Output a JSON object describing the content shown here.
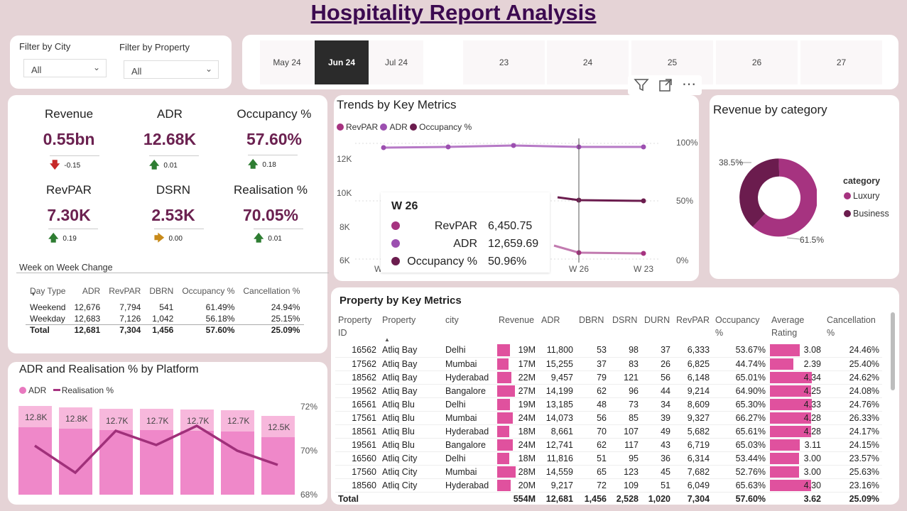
{
  "title": "Hospitality Report Analysis",
  "filters": {
    "city_label": "Filter by City",
    "city_value": "All",
    "property_label": "Filter by Property",
    "property_value": "All"
  },
  "slicer": {
    "items": [
      "May 24",
      "Jun 24",
      "Jul 24",
      "23",
      "24",
      "25",
      "26",
      "27"
    ],
    "selected": "Jun 24"
  },
  "kpis": [
    {
      "title": "Revenue",
      "value": "0.55bn",
      "delta": "-0.15",
      "trend": "down"
    },
    {
      "title": "ADR",
      "value": "12.68K",
      "delta": "0.01",
      "trend": "up"
    },
    {
      "title": "Occupancy %",
      "value": "57.60%",
      "delta": "0.18",
      "trend": "up"
    },
    {
      "title": "RevPAR",
      "value": "7.30K",
      "delta": "0.19",
      "trend": "up"
    },
    {
      "title": "DSRN",
      "value": "2.53K",
      "delta": "0.00",
      "trend": "flat"
    },
    {
      "title": "Realisation %",
      "value": "70.05%",
      "delta": "0.01",
      "trend": "up"
    }
  ],
  "week_table": {
    "title": "Week on Week Change",
    "headers": [
      "Day Type",
      "ADR",
      "RevPAR",
      "DBRN",
      "Occupancy %",
      "Cancellation %"
    ],
    "rows": [
      [
        "Weekend",
        "12,676",
        "7,794",
        "541",
        "61.49%",
        "24.94%"
      ],
      [
        "Weekday",
        "12,683",
        "7,126",
        "1,042",
        "56.18%",
        "25.15%"
      ]
    ],
    "total": [
      "Total",
      "12,681",
      "7,304",
      "1,456",
      "57.60%",
      "25.09%"
    ]
  },
  "trends": {
    "title": "Trends by Key Metrics",
    "legend": [
      "RevPAR",
      "ADR",
      "Occupancy %"
    ],
    "y_ticks": [
      "12K",
      "10K",
      "8K",
      "6K"
    ],
    "y2_ticks": [
      "100%",
      "50%",
      "0%"
    ],
    "x_ticks": [
      "W 26",
      "W 23"
    ],
    "x_partial": "W",
    "tooltip": {
      "title": "W 26",
      "rows": [
        {
          "label": "RevPAR",
          "value": "6,450.75"
        },
        {
          "label": "ADR",
          "value": "12,659.69"
        },
        {
          "label": "Occupancy %",
          "value": "50.96%"
        }
      ]
    }
  },
  "category": {
    "title": "Revenue by category",
    "legend_title": "category",
    "items": [
      "Luxury",
      "Business"
    ],
    "labels": [
      "38.5%",
      "61.5%"
    ]
  },
  "platform": {
    "title": "ADR and Realisation % by Platform",
    "legend": [
      "ADR",
      "Realisation %"
    ],
    "bar_labels": [
      "12.8K",
      "12.8K",
      "12.7K",
      "12.7K",
      "12.7K",
      "12.7K",
      "12.5K"
    ],
    "y2_ticks": [
      "72%",
      "70%",
      "68%"
    ]
  },
  "property_table": {
    "title": "Property by Key Metrics",
    "headers": [
      "Property ID",
      "Property",
      "city",
      "Revenue",
      "ADR",
      "DBRN",
      "DSRN",
      "DURN",
      "RevPAR",
      "Occupancy %",
      "Average Rating",
      "Cancellation %"
    ],
    "rows": [
      [
        "16562",
        "Atliq Bay",
        "Delhi",
        "19M",
        "11,800",
        "53",
        "98",
        "37",
        "6,333",
        "53.67%",
        "3.08",
        "24.46%"
      ],
      [
        "17562",
        "Atliq Bay",
        "Mumbai",
        "17M",
        "15,255",
        "37",
        "83",
        "26",
        "6,825",
        "44.74%",
        "2.39",
        "25.40%"
      ],
      [
        "18562",
        "Atliq Bay",
        "Hyderabad",
        "22M",
        "9,457",
        "79",
        "121",
        "56",
        "6,148",
        "65.01%",
        "4.34",
        "24.62%"
      ],
      [
        "19562",
        "Atliq Bay",
        "Bangalore",
        "27M",
        "14,199",
        "62",
        "96",
        "44",
        "9,214",
        "64.90%",
        "4.25",
        "24.08%"
      ],
      [
        "16561",
        "Atliq Blu",
        "Delhi",
        "19M",
        "13,185",
        "48",
        "73",
        "34",
        "8,609",
        "65.30%",
        "4.33",
        "24.76%"
      ],
      [
        "17561",
        "Atliq Blu",
        "Mumbai",
        "24M",
        "14,073",
        "56",
        "85",
        "39",
        "9,327",
        "66.27%",
        "4.28",
        "26.33%"
      ],
      [
        "18561",
        "Atliq Blu",
        "Hyderabad",
        "18M",
        "8,661",
        "70",
        "107",
        "49",
        "5,682",
        "65.61%",
        "4.28",
        "24.17%"
      ],
      [
        "19561",
        "Atliq Blu",
        "Bangalore",
        "24M",
        "12,741",
        "62",
        "117",
        "43",
        "6,719",
        "65.03%",
        "3.11",
        "24.15%"
      ],
      [
        "16560",
        "Atliq City",
        "Delhi",
        "18M",
        "11,816",
        "51",
        "95",
        "36",
        "6,314",
        "53.44%",
        "3.00",
        "23.57%"
      ],
      [
        "17560",
        "Atliq City",
        "Mumbai",
        "28M",
        "14,559",
        "65",
        "123",
        "45",
        "7,682",
        "52.76%",
        "3.00",
        "25.63%"
      ],
      [
        "18560",
        "Atliq City",
        "Hyderabad",
        "20M",
        "9,217",
        "72",
        "109",
        "51",
        "6,049",
        "65.63%",
        "4.30",
        "23.16%"
      ]
    ],
    "total": [
      "Total",
      "",
      "",
      "554M",
      "12,681",
      "1,456",
      "2,528",
      "1,020",
      "7,304",
      "57.60%",
      "3.62",
      "25.09%"
    ]
  },
  "colors": {
    "revpar": "#a63380",
    "adr": "#9c4fb0",
    "occupancy": "#6b1c4e",
    "bar_pink": "#e0519e",
    "luxury": "#a63380",
    "business": "#6b1c4e"
  }
}
